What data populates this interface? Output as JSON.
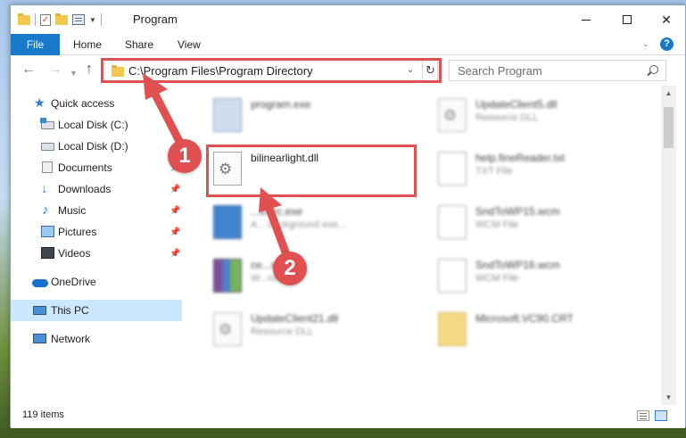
{
  "window": {
    "title": "Program",
    "ribbon_tabs": {
      "file": "File",
      "home": "Home",
      "share": "Share",
      "view": "View"
    },
    "help_label": "?"
  },
  "navigation": {
    "address": "C:\\Program Files\\Program Directory",
    "search_placeholder": "Search Program"
  },
  "sidebar": {
    "items": [
      {
        "label": "Quick access",
        "icon": "star-icon"
      },
      {
        "label": "Local Disk (C:)",
        "icon": "drive-icon"
      },
      {
        "label": "Local Disk (D:)",
        "icon": "drive-icon"
      },
      {
        "label": "Documents",
        "icon": "documents-icon",
        "pinned": true
      },
      {
        "label": "Downloads",
        "icon": "downloads-icon",
        "pinned": true
      },
      {
        "label": "Music",
        "icon": "music-icon",
        "pinned": true
      },
      {
        "label": "Pictures",
        "icon": "pictures-icon",
        "pinned": true
      },
      {
        "label": "Videos",
        "icon": "videos-icon",
        "pinned": true
      },
      {
        "label": "OneDrive",
        "icon": "cloud-icon"
      },
      {
        "label": "This PC",
        "icon": "computer-icon",
        "selected": true
      },
      {
        "label": "Network",
        "icon": "network-icon"
      }
    ]
  },
  "files": {
    "left": [
      {
        "name": "program.exe",
        "type": ""
      },
      {
        "name": "bilinearlight.dll",
        "type": ""
      },
      {
        "name": "...exec.exe",
        "type": "A... background exe..."
      },
      {
        "name": "ce...s.cab",
        "type": "W...rchive"
      },
      {
        "name": "UpdateClient21.dll",
        "type": "Resource DLL"
      }
    ],
    "right": [
      {
        "name": "UpdateClient5.dll",
        "type": "Resource DLL"
      },
      {
        "name": "help.fineReader.txt",
        "type": "TXT File"
      },
      {
        "name": "SndToWP15.wcm",
        "type": "WCM File"
      },
      {
        "name": "SndToWP16.wcm",
        "type": "WCM File"
      },
      {
        "name": "Microsoft.VC90.CRT",
        "type": ""
      }
    ]
  },
  "status": {
    "item_count": "119 items"
  },
  "annotations": {
    "step1": "1",
    "step2": "2"
  },
  "colors": {
    "accent": "#1979ca",
    "highlight": "#e05050",
    "selected": "#cce8ff"
  }
}
